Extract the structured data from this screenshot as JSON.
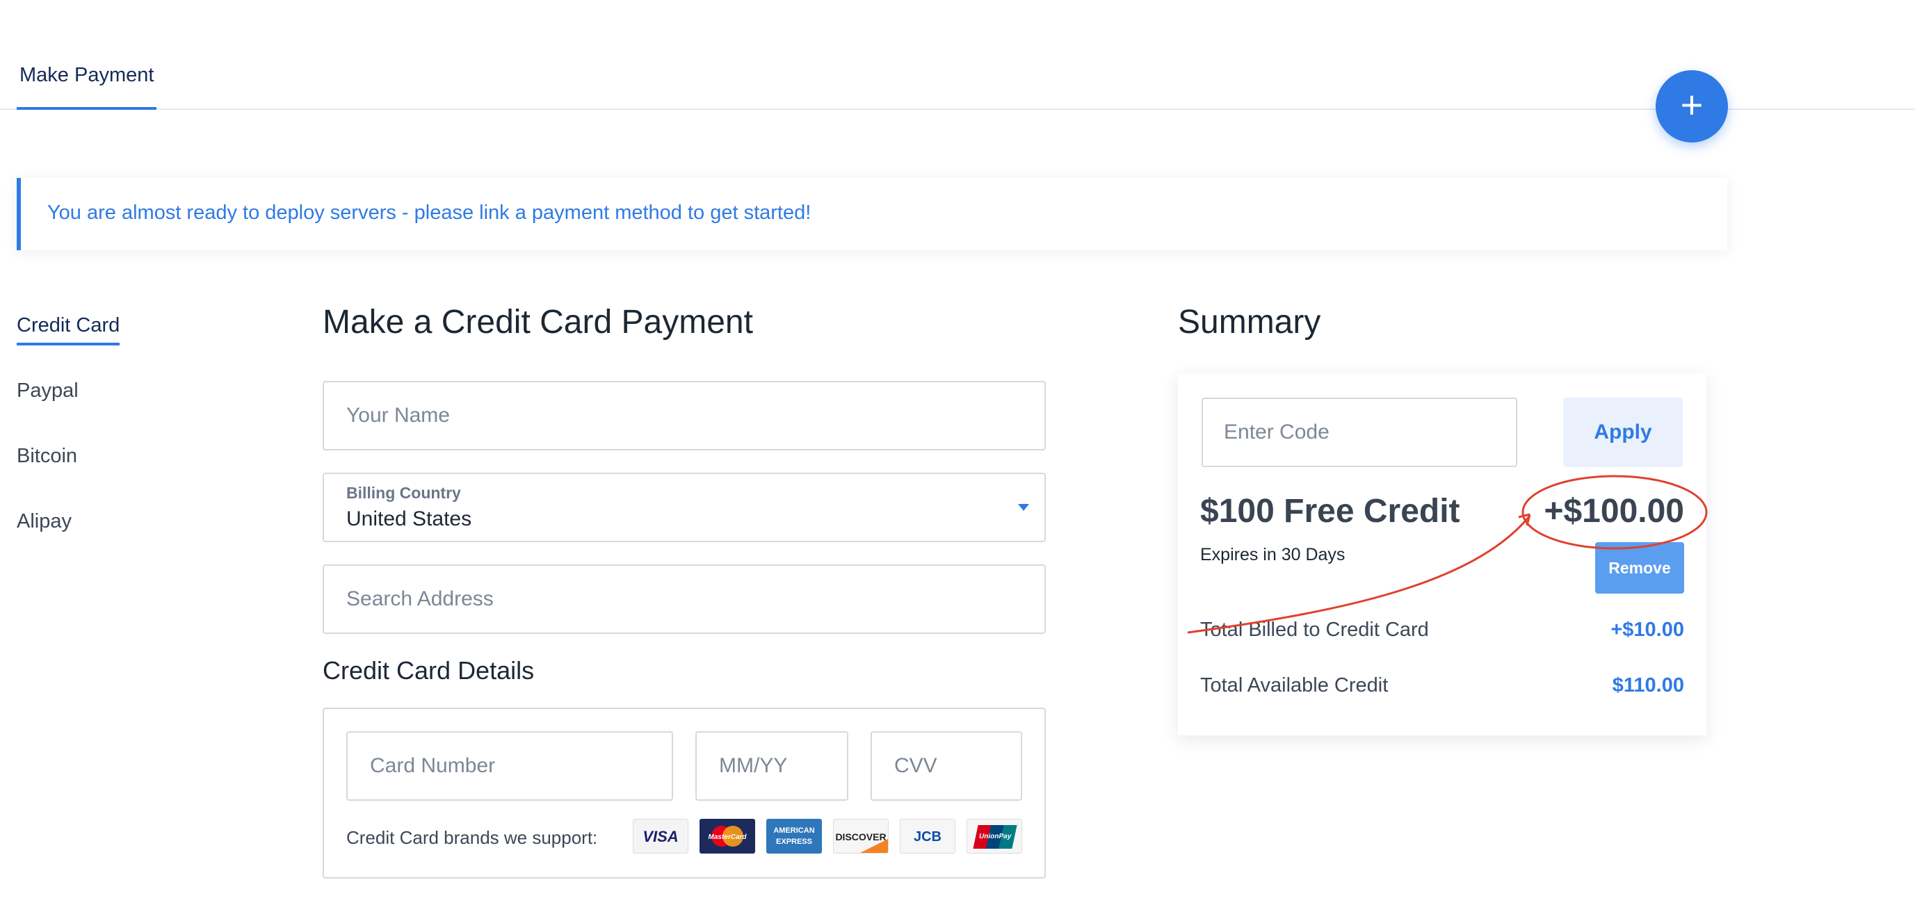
{
  "tabs": {
    "active_label": "Make Payment"
  },
  "fab": {
    "label": "+"
  },
  "banner": {
    "text": "You are almost ready to deploy servers - please link a payment method to get started!"
  },
  "payment_methods": [
    {
      "label": "Credit Card",
      "active": true
    },
    {
      "label": "Paypal",
      "active": false
    },
    {
      "label": "Bitcoin",
      "active": false
    },
    {
      "label": "Alipay",
      "active": false
    }
  ],
  "form": {
    "title": "Make a Credit Card Payment",
    "name_placeholder": "Your Name",
    "country_label": "Billing Country",
    "country_value": "United States",
    "address_placeholder": "Search Address",
    "cc_title": "Credit Card Details",
    "card_number_placeholder": "Card Number",
    "expiry_placeholder": "MM/YY",
    "cvv_placeholder": "CVV",
    "brands_label": "Credit Card brands we support:",
    "brands": [
      "VISA",
      "MasterCard",
      "AMERICAN EXPRESS",
      "DISCOVER",
      "JCB",
      "UnionPay 银联"
    ]
  },
  "summary": {
    "title": "Summary",
    "code_placeholder": "Enter Code",
    "apply_label": "Apply",
    "promo_name": "$100 Free Credit",
    "promo_amount": "+$100.00",
    "expires": "Expires in 30 Days",
    "remove_label": "Remove",
    "billed_label": "Total Billed to Credit Card",
    "billed_value": "+$10.00",
    "available_label": "Total Available Credit",
    "available_value": "$110.00"
  },
  "colors": {
    "accent": "#2f7ae5",
    "heading": "#142a57",
    "annotation": "#e0412f"
  }
}
